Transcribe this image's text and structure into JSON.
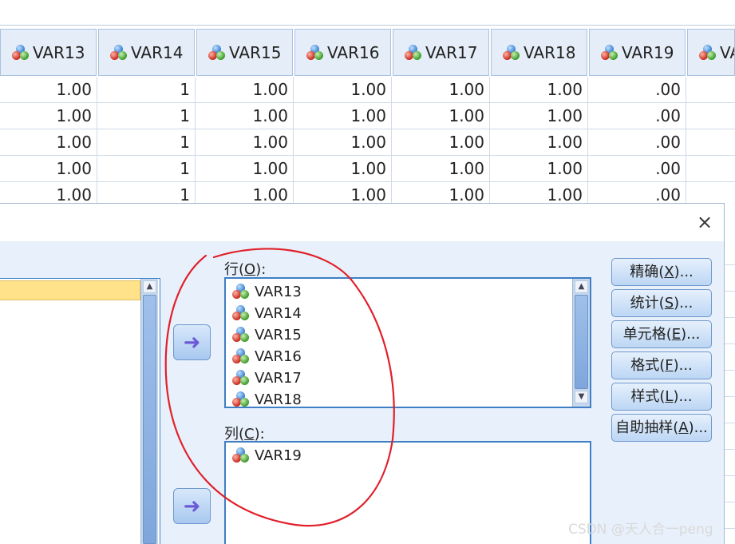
{
  "grid": {
    "columns": [
      "VAR13",
      "VAR14",
      "VAR15",
      "VAR16",
      "VAR17",
      "VAR18",
      "VAR19",
      "VA"
    ],
    "rows": [
      [
        "1.00",
        "1",
        "1.00",
        "1.00",
        "1.00",
        "1.00",
        ".00"
      ],
      [
        "1.00",
        "1",
        "1.00",
        "1.00",
        "1.00",
        "1.00",
        ".00"
      ],
      [
        "1.00",
        "1",
        "1.00",
        "1.00",
        "1.00",
        "1.00",
        ".00"
      ],
      [
        "1.00",
        "1",
        "1.00",
        "1.00",
        "1.00",
        "1.00",
        ".00"
      ],
      [
        "1.00",
        "1",
        "1.00",
        "1.00",
        "1.00",
        "1.00",
        ".00"
      ]
    ]
  },
  "dialog": {
    "close_glyph": "×",
    "rows_label": {
      "pre": "行(",
      "key": "O",
      "post": "):"
    },
    "cols_label": {
      "pre": "列(",
      "key": "C",
      "post": "):"
    },
    "rows_items": [
      "VAR13",
      "VAR14",
      "VAR15",
      "VAR16",
      "VAR17",
      "VAR18"
    ],
    "cols_items": [
      "VAR19"
    ],
    "buttons": [
      {
        "pre": "精确(",
        "key": "X",
        "post": ")..."
      },
      {
        "pre": "统计(",
        "key": "S",
        "post": ")..."
      },
      {
        "pre": "单元格(",
        "key": "E",
        "post": ")..."
      },
      {
        "pre": "格式(",
        "key": "F",
        "post": ")..."
      },
      {
        "pre": "样式(",
        "key": "L",
        "post": ")..."
      },
      {
        "pre": "自助抽样(",
        "key": "A",
        "post": ")..."
      }
    ]
  },
  "watermark": "CSDN @天人合一peng",
  "colors": {
    "annotation": "#e0202a",
    "selected_row": "#ffe28a",
    "list_border": "#3f7ec4",
    "dialog_bg": "#e8f1fb"
  },
  "icons": {
    "variable": "scale-variable-icon",
    "move": "move-arrow-icon",
    "close": "close-icon"
  }
}
